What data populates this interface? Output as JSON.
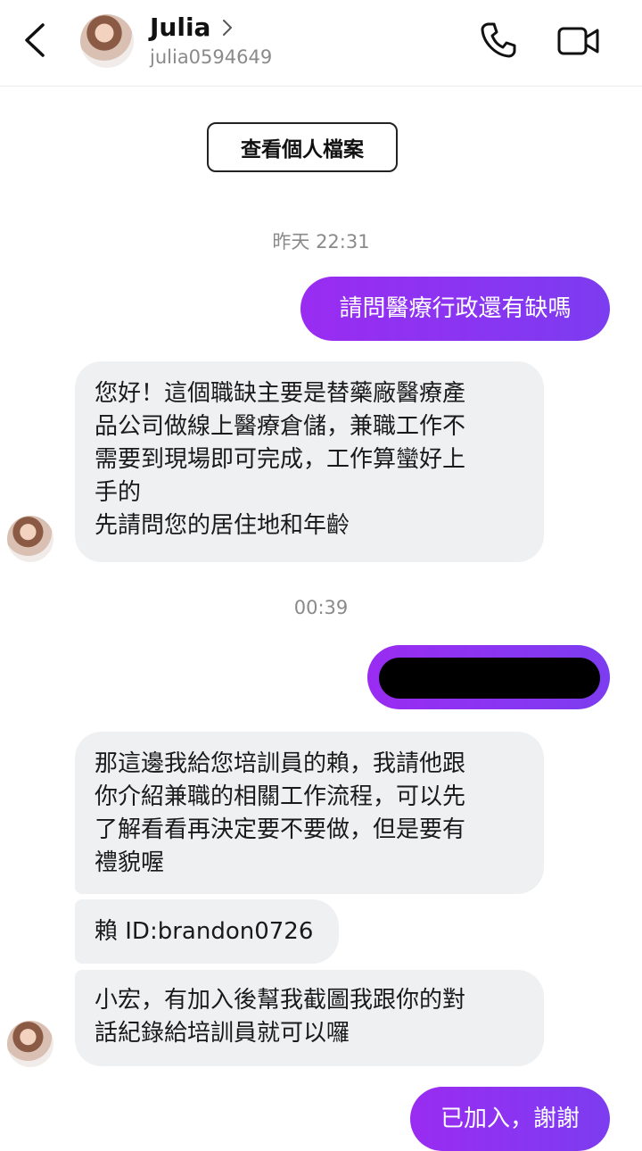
{
  "header": {
    "name": "Julia",
    "handle": "julia0594649"
  },
  "profile_button": "查看個人檔案",
  "timestamps": [
    "昨天 22:31",
    "00:39"
  ],
  "messages": {
    "sent_1": "請問醫療行政還有缺嗎",
    "recv_1": [
      "您好！這個職缺主要是替藥廠醫療產",
      "品公司做線上醫療倉儲，兼職工作不",
      "需要到現場即可完成，工作算蠻好上",
      "手的",
      "先請問您的居住地和年齡"
    ],
    "recv_2": [
      "那這邊我給您培訓員的賴，我請他跟",
      "你介紹兼職的相關工作流程，可以先",
      "了解看看再決定要不要做，但是要有",
      "禮貌喔"
    ],
    "recv_3": "賴 ID:brandon0726",
    "recv_4": [
      "小宏，有加入後幫我截圖我跟你的對",
      "話紀錄給培訓員就可以囉"
    ],
    "sent_3": "已加入，謝謝"
  },
  "colors": {
    "sent_bubble": "#8b35f1",
    "recv_bubble": "#eff0f2"
  },
  "icons": [
    "back-arrow-icon",
    "chevron-right-icon",
    "phone-icon",
    "video-camera-icon"
  ]
}
